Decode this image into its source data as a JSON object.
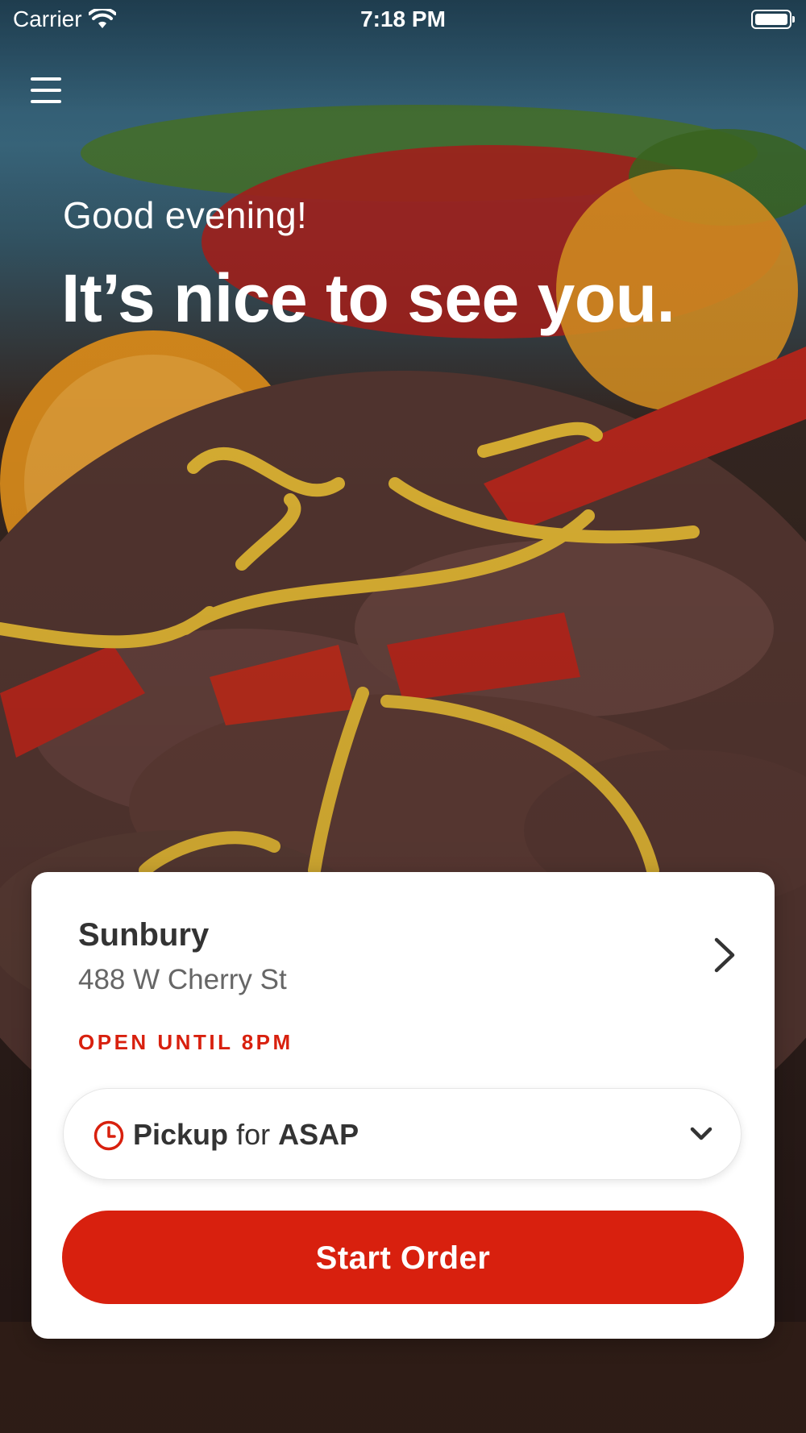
{
  "status_bar": {
    "carrier": "Carrier",
    "time": "7:18 PM"
  },
  "greeting": {
    "salutation": "Good evening!",
    "headline": "It’s nice to see you."
  },
  "location": {
    "name": "Sunbury",
    "address": "488 W Cherry St",
    "hours": "OPEN UNTIL 8PM"
  },
  "order_mode": {
    "mode": "Pickup",
    "connector": "for",
    "time": "ASAP"
  },
  "actions": {
    "start_order": "Start Order"
  },
  "icons": {
    "menu": "hamburger-menu-icon",
    "chevron": "chevron-right-icon",
    "clock": "clock-icon",
    "dropdown": "chevron-down-icon",
    "wifi": "wifi-icon",
    "battery": "battery-icon"
  },
  "colors": {
    "accent": "#d8200e",
    "card_background": "#ffffff",
    "primary_text": "#333333",
    "secondary_text": "#666666"
  }
}
